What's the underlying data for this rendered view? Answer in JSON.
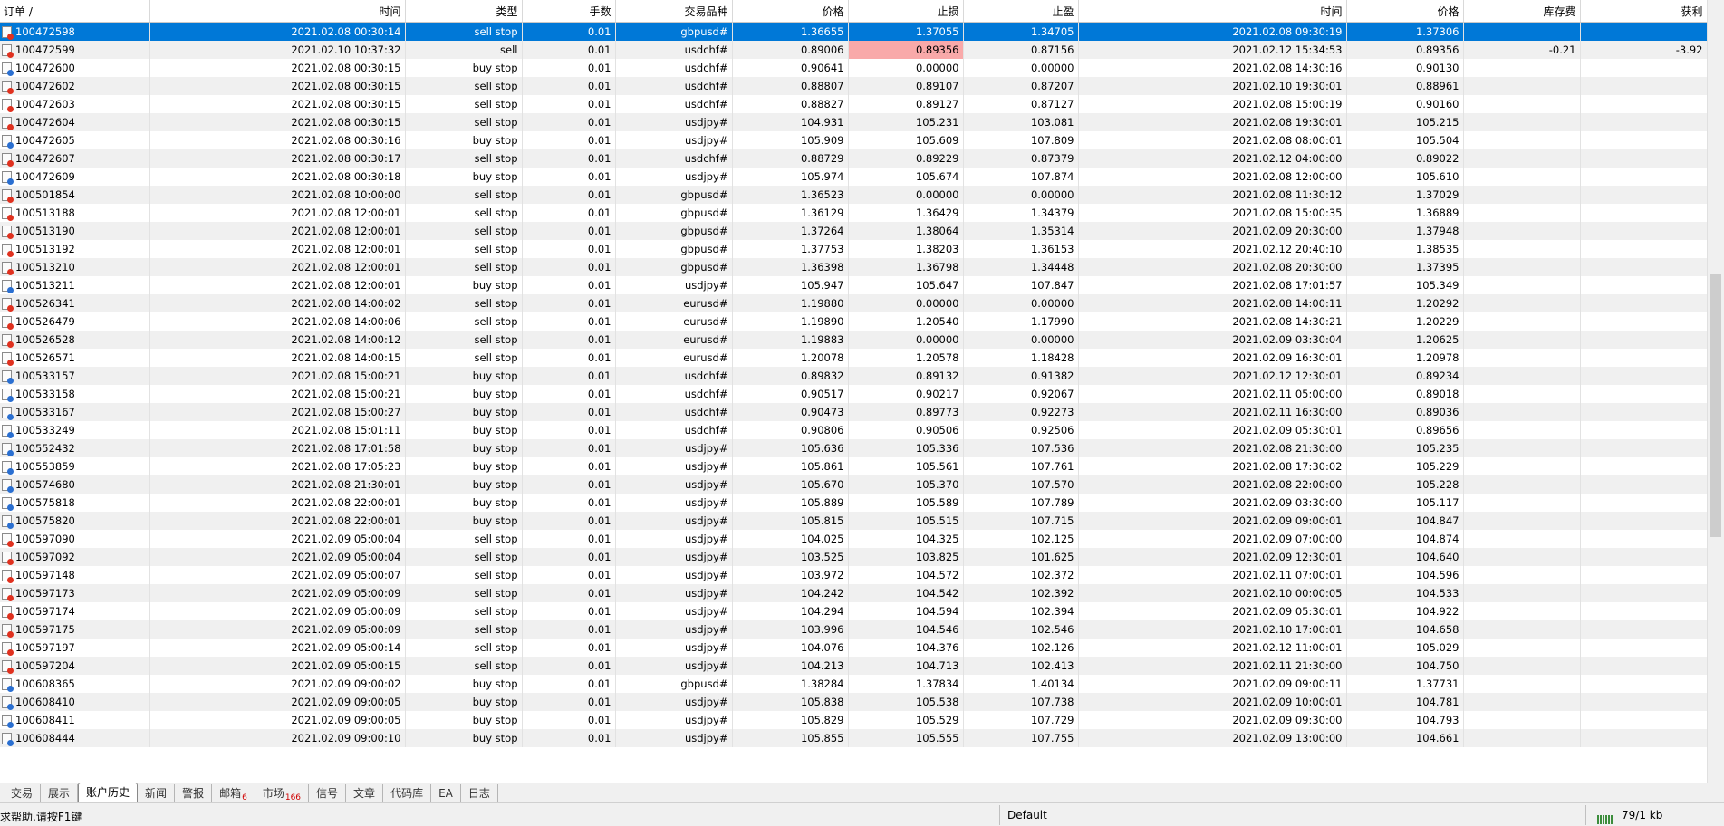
{
  "columns": [
    "订单 /",
    "时间",
    "类型",
    "手数",
    "交易品种",
    "价格",
    "止损",
    "止盈",
    "时间",
    "价格",
    "库存费",
    "获利"
  ],
  "rows": [
    [
      "100472598",
      "2021.02.08 00:30:14",
      "sell stop",
      "0.01",
      "gbpusd#",
      "1.36655",
      "1.37055",
      "1.34705",
      "2021.02.08 09:30:19",
      "1.37306",
      "",
      ""
    ],
    [
      "100472599",
      "2021.02.10 10:37:32",
      "sell",
      "0.01",
      "usdchf#",
      "0.89006",
      "0.89356",
      "0.87156",
      "2021.02.12 15:34:53",
      "0.89356",
      "-0.21",
      "-3.92"
    ],
    [
      "100472600",
      "2021.02.08 00:30:15",
      "buy stop",
      "0.01",
      "usdchf#",
      "0.90641",
      "0.00000",
      "0.00000",
      "2021.02.08 14:30:16",
      "0.90130",
      "",
      ""
    ],
    [
      "100472602",
      "2021.02.08 00:30:15",
      "sell stop",
      "0.01",
      "usdchf#",
      "0.88807",
      "0.89107",
      "0.87207",
      "2021.02.10 19:30:01",
      "0.88961",
      "",
      ""
    ],
    [
      "100472603",
      "2021.02.08 00:30:15",
      "sell stop",
      "0.01",
      "usdchf#",
      "0.88827",
      "0.89127",
      "0.87127",
      "2021.02.08 15:00:19",
      "0.90160",
      "",
      ""
    ],
    [
      "100472604",
      "2021.02.08 00:30:15",
      "sell stop",
      "0.01",
      "usdjpy#",
      "104.931",
      "105.231",
      "103.081",
      "2021.02.08 19:30:01",
      "105.215",
      "",
      ""
    ],
    [
      "100472605",
      "2021.02.08 00:30:16",
      "buy stop",
      "0.01",
      "usdjpy#",
      "105.909",
      "105.609",
      "107.809",
      "2021.02.08 08:00:01",
      "105.504",
      "",
      ""
    ],
    [
      "100472607",
      "2021.02.08 00:30:17",
      "sell stop",
      "0.01",
      "usdchf#",
      "0.88729",
      "0.89229",
      "0.87379",
      "2021.02.12 04:00:00",
      "0.89022",
      "",
      ""
    ],
    [
      "100472609",
      "2021.02.08 00:30:18",
      "buy stop",
      "0.01",
      "usdjpy#",
      "105.974",
      "105.674",
      "107.874",
      "2021.02.08 12:00:00",
      "105.610",
      "",
      ""
    ],
    [
      "100501854",
      "2021.02.08 10:00:00",
      "sell stop",
      "0.01",
      "gbpusd#",
      "1.36523",
      "0.00000",
      "0.00000",
      "2021.02.08 11:30:12",
      "1.37029",
      "",
      ""
    ],
    [
      "100513188",
      "2021.02.08 12:00:01",
      "sell stop",
      "0.01",
      "gbpusd#",
      "1.36129",
      "1.36429",
      "1.34379",
      "2021.02.08 15:00:35",
      "1.36889",
      "",
      ""
    ],
    [
      "100513190",
      "2021.02.08 12:00:01",
      "sell stop",
      "0.01",
      "gbpusd#",
      "1.37264",
      "1.38064",
      "1.35314",
      "2021.02.09 20:30:00",
      "1.37948",
      "",
      ""
    ],
    [
      "100513192",
      "2021.02.08 12:00:01",
      "sell stop",
      "0.01",
      "gbpusd#",
      "1.37753",
      "1.38203",
      "1.36153",
      "2021.02.12 20:40:10",
      "1.38535",
      "",
      ""
    ],
    [
      "100513210",
      "2021.02.08 12:00:01",
      "sell stop",
      "0.01",
      "gbpusd#",
      "1.36398",
      "1.36798",
      "1.34448",
      "2021.02.08 20:30:00",
      "1.37395",
      "",
      ""
    ],
    [
      "100513211",
      "2021.02.08 12:00:01",
      "buy stop",
      "0.01",
      "usdjpy#",
      "105.947",
      "105.647",
      "107.847",
      "2021.02.08 17:01:57",
      "105.349",
      "",
      ""
    ],
    [
      "100526341",
      "2021.02.08 14:00:02",
      "sell stop",
      "0.01",
      "eurusd#",
      "1.19880",
      "0.00000",
      "0.00000",
      "2021.02.08 14:00:11",
      "1.20292",
      "",
      ""
    ],
    [
      "100526479",
      "2021.02.08 14:00:06",
      "sell stop",
      "0.01",
      "eurusd#",
      "1.19890",
      "1.20540",
      "1.17990",
      "2021.02.08 14:30:21",
      "1.20229",
      "",
      ""
    ],
    [
      "100526528",
      "2021.02.08 14:00:12",
      "sell stop",
      "0.01",
      "eurusd#",
      "1.19883",
      "0.00000",
      "0.00000",
      "2021.02.09 03:30:04",
      "1.20625",
      "",
      ""
    ],
    [
      "100526571",
      "2021.02.08 14:00:15",
      "sell stop",
      "0.01",
      "eurusd#",
      "1.20078",
      "1.20578",
      "1.18428",
      "2021.02.09 16:30:01",
      "1.20978",
      "",
      ""
    ],
    [
      "100533157",
      "2021.02.08 15:00:21",
      "buy stop",
      "0.01",
      "usdchf#",
      "0.89832",
      "0.89132",
      "0.91382",
      "2021.02.12 12:30:01",
      "0.89234",
      "",
      ""
    ],
    [
      "100533158",
      "2021.02.08 15:00:21",
      "buy stop",
      "0.01",
      "usdchf#",
      "0.90517",
      "0.90217",
      "0.92067",
      "2021.02.11 05:00:00",
      "0.89018",
      "",
      ""
    ],
    [
      "100533167",
      "2021.02.08 15:00:27",
      "buy stop",
      "0.01",
      "usdchf#",
      "0.90473",
      "0.89773",
      "0.92273",
      "2021.02.11 16:30:00",
      "0.89036",
      "",
      ""
    ],
    [
      "100533249",
      "2021.02.08 15:01:11",
      "buy stop",
      "0.01",
      "usdchf#",
      "0.90806",
      "0.90506",
      "0.92506",
      "2021.02.09 05:30:01",
      "0.89656",
      "",
      ""
    ],
    [
      "100552432",
      "2021.02.08 17:01:58",
      "buy stop",
      "0.01",
      "usdjpy#",
      "105.636",
      "105.336",
      "107.536",
      "2021.02.08 21:30:00",
      "105.235",
      "",
      ""
    ],
    [
      "100553859",
      "2021.02.08 17:05:23",
      "buy stop",
      "0.01",
      "usdjpy#",
      "105.861",
      "105.561",
      "107.761",
      "2021.02.08 17:30:02",
      "105.229",
      "",
      ""
    ],
    [
      "100574680",
      "2021.02.08 21:30:01",
      "buy stop",
      "0.01",
      "usdjpy#",
      "105.670",
      "105.370",
      "107.570",
      "2021.02.08 22:00:00",
      "105.228",
      "",
      ""
    ],
    [
      "100575818",
      "2021.02.08 22:00:01",
      "buy stop",
      "0.01",
      "usdjpy#",
      "105.889",
      "105.589",
      "107.789",
      "2021.02.09 03:30:00",
      "105.117",
      "",
      ""
    ],
    [
      "100575820",
      "2021.02.08 22:00:01",
      "buy stop",
      "0.01",
      "usdjpy#",
      "105.815",
      "105.515",
      "107.715",
      "2021.02.09 09:00:01",
      "104.847",
      "",
      ""
    ],
    [
      "100597090",
      "2021.02.09 05:00:04",
      "sell stop",
      "0.01",
      "usdjpy#",
      "104.025",
      "104.325",
      "102.125",
      "2021.02.09 07:00:00",
      "104.874",
      "",
      ""
    ],
    [
      "100597092",
      "2021.02.09 05:00:04",
      "sell stop",
      "0.01",
      "usdjpy#",
      "103.525",
      "103.825",
      "101.625",
      "2021.02.09 12:30:01",
      "104.640",
      "",
      ""
    ],
    [
      "100597148",
      "2021.02.09 05:00:07",
      "sell stop",
      "0.01",
      "usdjpy#",
      "103.972",
      "104.572",
      "102.372",
      "2021.02.11 07:00:01",
      "104.596",
      "",
      ""
    ],
    [
      "100597173",
      "2021.02.09 05:00:09",
      "sell stop",
      "0.01",
      "usdjpy#",
      "104.242",
      "104.542",
      "102.392",
      "2021.02.10 00:00:05",
      "104.533",
      "",
      ""
    ],
    [
      "100597174",
      "2021.02.09 05:00:09",
      "sell stop",
      "0.01",
      "usdjpy#",
      "104.294",
      "104.594",
      "102.394",
      "2021.02.09 05:30:01",
      "104.922",
      "",
      ""
    ],
    [
      "100597175",
      "2021.02.09 05:00:09",
      "sell stop",
      "0.01",
      "usdjpy#",
      "103.996",
      "104.546",
      "102.546",
      "2021.02.10 17:00:01",
      "104.658",
      "",
      ""
    ],
    [
      "100597197",
      "2021.02.09 05:00:14",
      "sell stop",
      "0.01",
      "usdjpy#",
      "104.076",
      "104.376",
      "102.126",
      "2021.02.12 11:00:01",
      "105.029",
      "",
      ""
    ],
    [
      "100597204",
      "2021.02.09 05:00:15",
      "sell stop",
      "0.01",
      "usdjpy#",
      "104.213",
      "104.713",
      "102.413",
      "2021.02.11 21:30:00",
      "104.750",
      "",
      ""
    ],
    [
      "100608365",
      "2021.02.09 09:00:02",
      "buy stop",
      "0.01",
      "gbpusd#",
      "1.38284",
      "1.37834",
      "1.40134",
      "2021.02.09 09:00:11",
      "1.37731",
      "",
      ""
    ],
    [
      "100608410",
      "2021.02.09 09:00:05",
      "buy stop",
      "0.01",
      "usdjpy#",
      "105.838",
      "105.538",
      "107.738",
      "2021.02.09 10:00:01",
      "104.781",
      "",
      ""
    ],
    [
      "100608411",
      "2021.02.09 09:00:05",
      "buy stop",
      "0.01",
      "usdjpy#",
      "105.829",
      "105.529",
      "107.729",
      "2021.02.09 09:30:00",
      "104.793",
      "",
      ""
    ],
    [
      "100608444",
      "2021.02.09 09:00:10",
      "buy stop",
      "0.01",
      "usdjpy#",
      "105.855",
      "105.555",
      "107.755",
      "2021.02.09 13:00:00",
      "104.661",
      "",
      ""
    ]
  ],
  "selected_row": 0,
  "highlight_cell": {
    "row": 1,
    "col": 6,
    "color": "#f9a9a9"
  },
  "colors": {
    "selection": "#0078d7",
    "alt_row": "#f0f0f0",
    "buy_icon": "#2a6fd1",
    "sell_icon": "#e0311f",
    "badge": "#d00000"
  },
  "tabs": [
    {
      "label": "交易"
    },
    {
      "label": "展示"
    },
    {
      "label": "账户历史",
      "active": true
    },
    {
      "label": "新闻"
    },
    {
      "label": "警报"
    },
    {
      "label": "邮箱",
      "badge": "6"
    },
    {
      "label": "市场",
      "badge": "166"
    },
    {
      "label": "信号"
    },
    {
      "label": "文章"
    },
    {
      "label": "代码库"
    },
    {
      "label": "EA"
    },
    {
      "label": "日志"
    }
  ],
  "status": {
    "help": "求帮助,请按F1键",
    "profile": "Default",
    "connection": "79/1 kb"
  }
}
